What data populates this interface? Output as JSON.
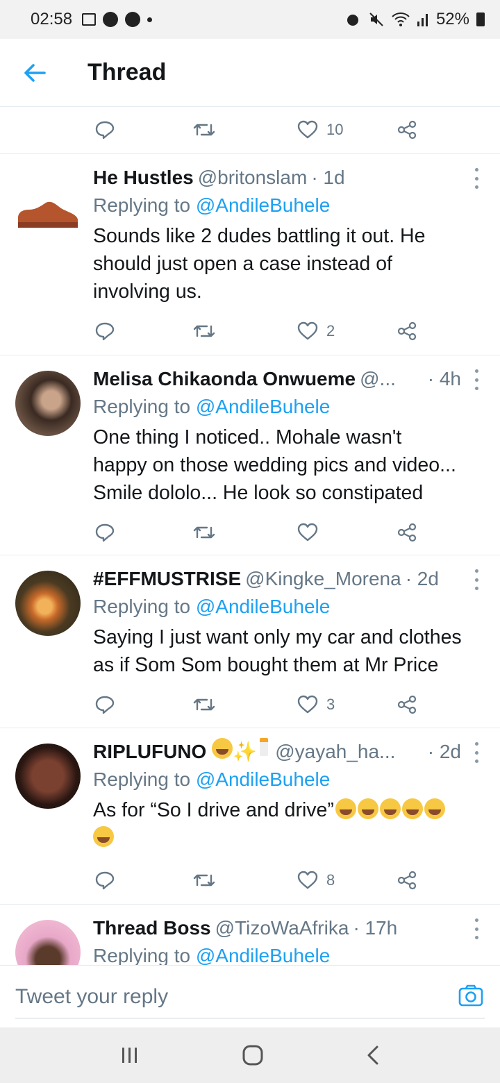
{
  "status_bar": {
    "time": "02:58",
    "battery": "52%"
  },
  "header": {
    "title": "Thread"
  },
  "partial_actions": {
    "like_count": "10"
  },
  "tweets": [
    {
      "name": "He Hustles",
      "handle": "@britonslam",
      "time": "· 1d",
      "replying_prefix": "Replying to",
      "replying_to": "@AndileBuhele",
      "lines": [
        "Sounds like 2 dudes battling it out. He",
        "should just open a case instead of",
        "involving us."
      ],
      "like_count": "2"
    },
    {
      "name": "Melisa Chikaonda Onwueme",
      "handle": "@...",
      "time": "· 4h",
      "replying_prefix": "Replying to",
      "replying_to": "@AndileBuhele",
      "lines": [
        "One thing I noticed..  Mohale wasn't",
        "happy on those wedding pics and video...",
        "Smile dololo...  He look so constipated"
      ],
      "like_count": ""
    },
    {
      "name": "#EFFMUSTRISE",
      "handle": "@Kingke_Morena",
      "time": "· 2d",
      "replying_prefix": "Replying to",
      "replying_to": "@AndileBuhele",
      "lines": [
        "Saying I just want only my car and clothes",
        "as if Som Som bought them at Mr Price"
      ],
      "like_count": "3"
    },
    {
      "name": "RIPLUFUNO",
      "handle": "@yayah_ha...",
      "time": "· 2d",
      "replying_prefix": "Replying to",
      "replying_to": "@AndileBuhele",
      "lines": [
        "As for “So I drive and drive”"
      ],
      "like_count": "8"
    },
    {
      "name": "Thread Boss",
      "handle": "@TizoWaAfrika",
      "time": "· 17h",
      "replying_prefix": "Replying to",
      "replying_to": "@AndileBuhele"
    }
  ],
  "reply_bar": {
    "placeholder": "Tweet your reply"
  },
  "colors": {
    "accent": "#1da1f2",
    "muted": "#657786",
    "divider": "#e6ecf0"
  }
}
